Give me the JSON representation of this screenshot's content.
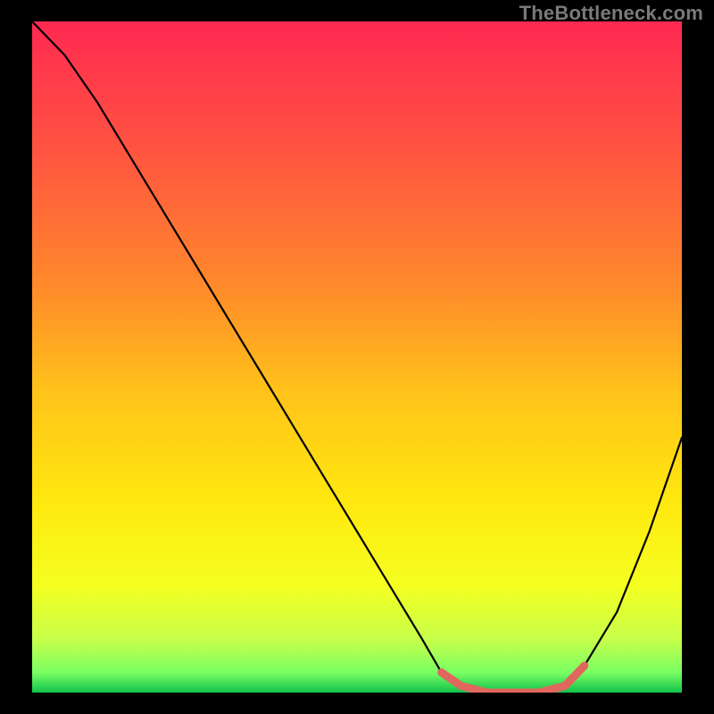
{
  "watermark": "TheBottleneck.com",
  "colors": {
    "valley_stroke": "#e0675e",
    "curve_stroke": "#000000",
    "gradient_stops": [
      {
        "offset": 0.0,
        "color": "#ff2952"
      },
      {
        "offset": 0.2,
        "color": "#ff5640"
      },
      {
        "offset": 0.4,
        "color": "#ff8b2a"
      },
      {
        "offset": 0.55,
        "color": "#ffc21a"
      },
      {
        "offset": 0.72,
        "color": "#ffe90f"
      },
      {
        "offset": 0.84,
        "color": "#f5ff20"
      },
      {
        "offset": 0.92,
        "color": "#c8ff4a"
      },
      {
        "offset": 0.97,
        "color": "#7aff62"
      },
      {
        "offset": 1.0,
        "color": "#11c24c"
      }
    ]
  },
  "chart_data": {
    "type": "line",
    "title": "",
    "xlabel": "",
    "ylabel": "",
    "xlim": [
      0,
      100
    ],
    "ylim": [
      0,
      100
    ],
    "x": [
      0,
      5,
      10,
      15,
      20,
      25,
      30,
      35,
      40,
      45,
      50,
      55,
      60,
      63,
      66,
      70,
      74,
      78,
      82,
      85,
      90,
      95,
      100
    ],
    "values": [
      100,
      95,
      88,
      80,
      72,
      64,
      56,
      48,
      40,
      32,
      24,
      16,
      8,
      3,
      1,
      0,
      0,
      0,
      1,
      4,
      12,
      24,
      38
    ],
    "notes": "Bottleneck-style curve: steep descent from top-left, flat minimum around x≈66–80, then rise toward right edge. Background is a vertical red→yellow→green gradient; curve is black; flat valley segment overlaid in salmon."
  }
}
